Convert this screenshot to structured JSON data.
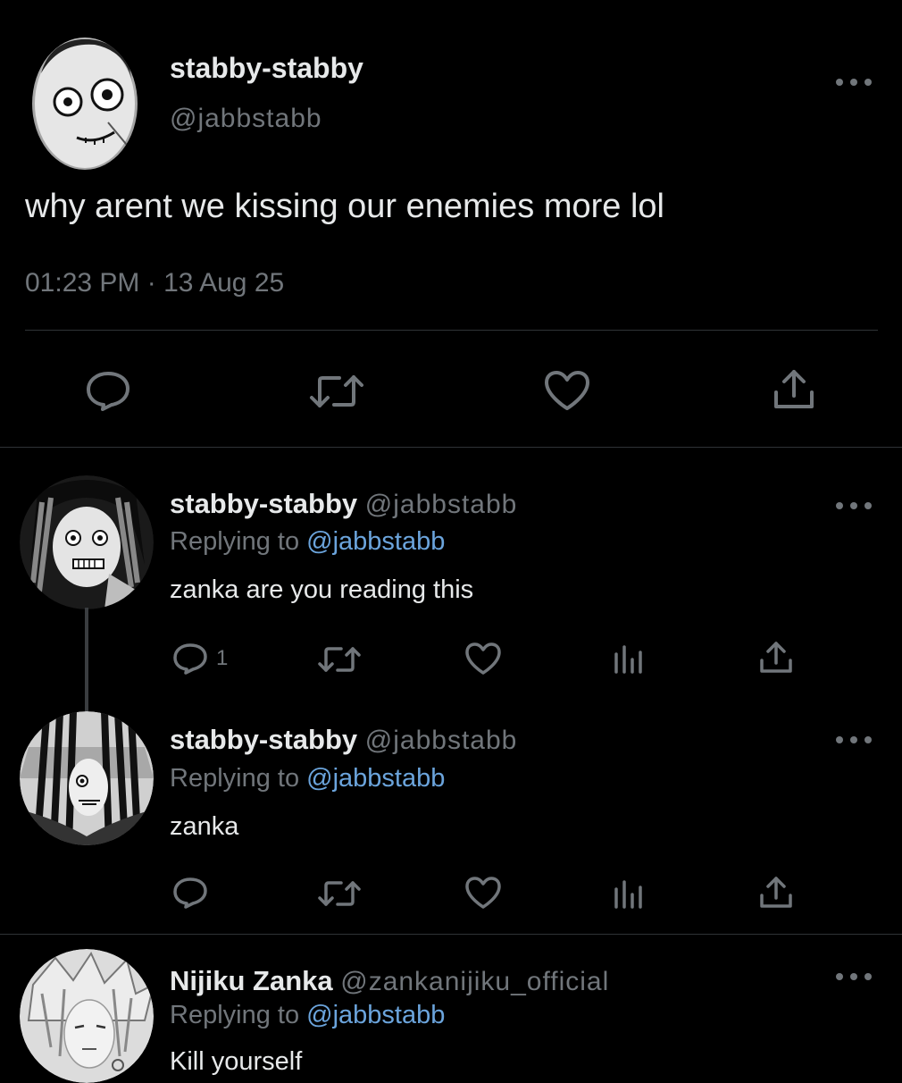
{
  "main_tweet": {
    "author_name": "stabby-stabby",
    "author_handle": "@jabbstabb",
    "text": "why arent we kissing our enemies more lol",
    "timestamp": "01:23 PM · 13 Aug 25",
    "actions": [
      "reply-icon",
      "retweet-icon",
      "like-icon",
      "share-icon"
    ]
  },
  "replies": [
    {
      "author_name": "stabby-stabby",
      "author_handle": "@jabbstabb",
      "replying_prefix": "Replying to",
      "replying_to": "@jabbstabb",
      "text": "zanka are you reading this",
      "reply_count": "1"
    },
    {
      "author_name": "stabby-stabby",
      "author_handle": "@jabbstabb",
      "replying_prefix": "Replying to",
      "replying_to": "@jabbstabb",
      "text": "zanka",
      "reply_count": ""
    },
    {
      "author_name": "Nijiku Zanka",
      "author_handle": "@zankanijiku_official",
      "replying_prefix": "Replying to",
      "replying_to": "@jabbstabb",
      "text": "Kill yourself",
      "reply_count": ""
    }
  ],
  "colors": {
    "background": "#000000",
    "primary_text": "#e7e9ea",
    "secondary_text": "#71767b",
    "mention": "#6ba4dc",
    "divider": "#2f3336"
  }
}
